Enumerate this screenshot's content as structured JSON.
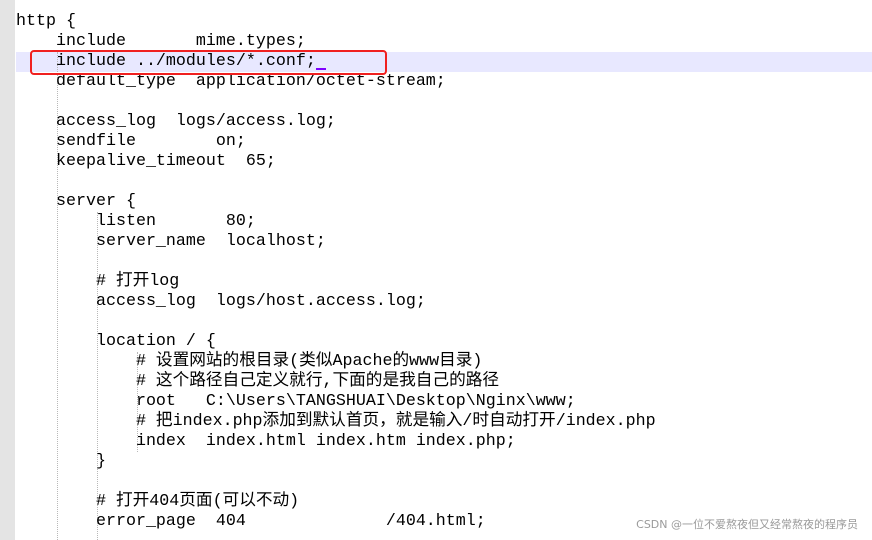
{
  "editor": {
    "lines": [
      "http {",
      "    include       mime.types;",
      "    include ../modules/*.conf;",
      "    default_type  application/octet-stream;",
      "",
      "    access_log  logs/access.log;",
      "    sendfile        on;",
      "    keepalive_timeout  65;",
      "",
      "    server {",
      "        listen       80;",
      "        server_name  localhost;",
      "",
      "        # 打开log",
      "        access_log  logs/host.access.log;",
      "",
      "        location / {",
      "            # 设置网站的根目录(类似Apache的www目录)",
      "            # 这个路径自己定义就行,下面的是我自己的路径",
      "            root   C:\\Users\\TANGSHUAI\\Desktop\\Nginx\\www;",
      "            # 把index.php添加到默认首页，就是输入/时自动打开/index.php",
      "            index  index.html index.htm index.php;",
      "        }",
      "",
      "        # 打开404页面(可以不动)",
      "        error_page  404              /404.html;"
    ],
    "current_line_index": 2,
    "highlight_color": "#e8e8ff",
    "annotation_box_color": "#f02020"
  },
  "watermark": "CSDN @一位不爱熬夜但又经常熬夜的程序员"
}
